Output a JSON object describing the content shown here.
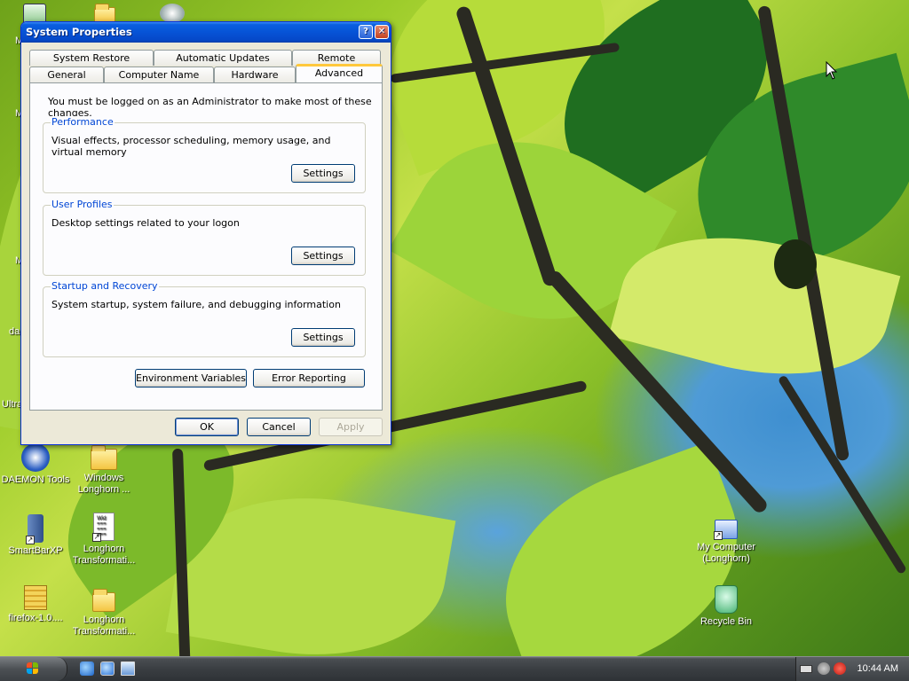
{
  "window": {
    "title": "System Properties",
    "help_label": "?",
    "close_label": "✕",
    "tabs_row1": [
      {
        "label": "System Restore"
      },
      {
        "label": "Automatic Updates"
      },
      {
        "label": "Remote"
      }
    ],
    "tabs_row2": [
      {
        "label": "General"
      },
      {
        "label": "Computer Name"
      },
      {
        "label": "Hardware"
      },
      {
        "label": "Advanced",
        "active": true
      }
    ],
    "admin_notice": "You must be logged on as an Administrator to make most of these changes.",
    "groups": {
      "performance": {
        "title": "Performance",
        "description": "Visual effects, processor scheduling, memory usage, and virtual memory",
        "button": "Settings"
      },
      "user_profiles": {
        "title": "User Profiles",
        "description": "Desktop settings related to your logon",
        "button": "Settings"
      },
      "startup_recovery": {
        "title": "Startup and Recovery",
        "description": "System startup, system failure, and debugging information",
        "button": "Settings"
      }
    },
    "env_vars_button": "Environment Variables",
    "error_reporting_button": "Error Reporting",
    "ok_button": "OK",
    "cancel_button": "Cancel",
    "apply_button": "Apply"
  },
  "desktop": {
    "partial_labels": [
      "M",
      "da",
      "Ultra"
    ],
    "icons": [
      {
        "label": "DAEMON Tools",
        "icon": "daemon-tools-icon"
      },
      {
        "label": "Windows Longhorn ...",
        "icon": "folder-icon"
      },
      {
        "label": "SmartBarXP",
        "icon": "smartbarxp-icon"
      },
      {
        "label": "Longhorn Transformati...",
        "icon": "document-icon"
      },
      {
        "label": "firefox-1.0....",
        "icon": "zip-folder-icon"
      },
      {
        "label": "Longhorn Transformati...",
        "icon": "folder-icon"
      },
      {
        "label": "My Computer (Longhorn)",
        "icon": "my-computer-icon"
      },
      {
        "label": "Recycle Bin",
        "icon": "recycle-bin-icon"
      }
    ]
  },
  "taskbar": {
    "start_icon": "windows-logo-icon",
    "quick_launch": [
      "internet-explorer-icon",
      "ie-alt-icon",
      "show-desktop-icon"
    ],
    "tray_icons": [
      "keyboard-icon",
      "tray-expand-icon",
      "shield-alert-icon"
    ],
    "clock": "10:44 AM"
  },
  "colors": {
    "title_bar": "#0653d6",
    "group_title": "#0046d5",
    "tab_highlight": "#ffc83c",
    "dialog_face": "#ece9d8"
  }
}
